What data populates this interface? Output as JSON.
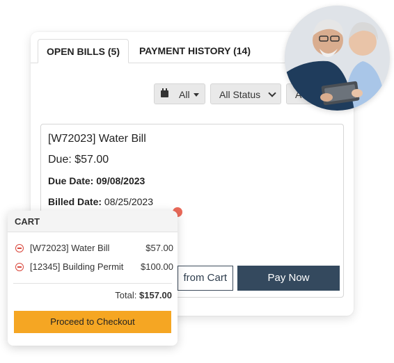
{
  "tabs": {
    "open_bills": "OPEN BILLS (5)",
    "payment_history": "PAYMENT HISTORY (14)"
  },
  "filters": {
    "date_value": "All",
    "status_value": "All Status",
    "extra_value": "A"
  },
  "bill": {
    "title": "[W72023] Water Bill",
    "due": "Due: $57.00",
    "due_date_label": "Due Date:",
    "due_date_value": "09/08/2023",
    "billed_date_label": "Billed Date:",
    "billed_date_value": "08/25/2023",
    "remove_button": "from Cart",
    "pay_button": "Pay Now"
  },
  "cart": {
    "title": "CART",
    "items": [
      {
        "name": "[W72023] Water Bill",
        "amount": "$57.00"
      },
      {
        "name": "[12345] Building Permit",
        "amount": "$100.00"
      }
    ],
    "total_label": "Total:",
    "total_value": "$157.00",
    "checkout_button": "Proceed to Checkout"
  },
  "colors": {
    "accent_orange": "#f5a623",
    "pay_button": "#34495e",
    "remove_icon": "#d9463b",
    "notification_dot": "#ea6a5a"
  }
}
